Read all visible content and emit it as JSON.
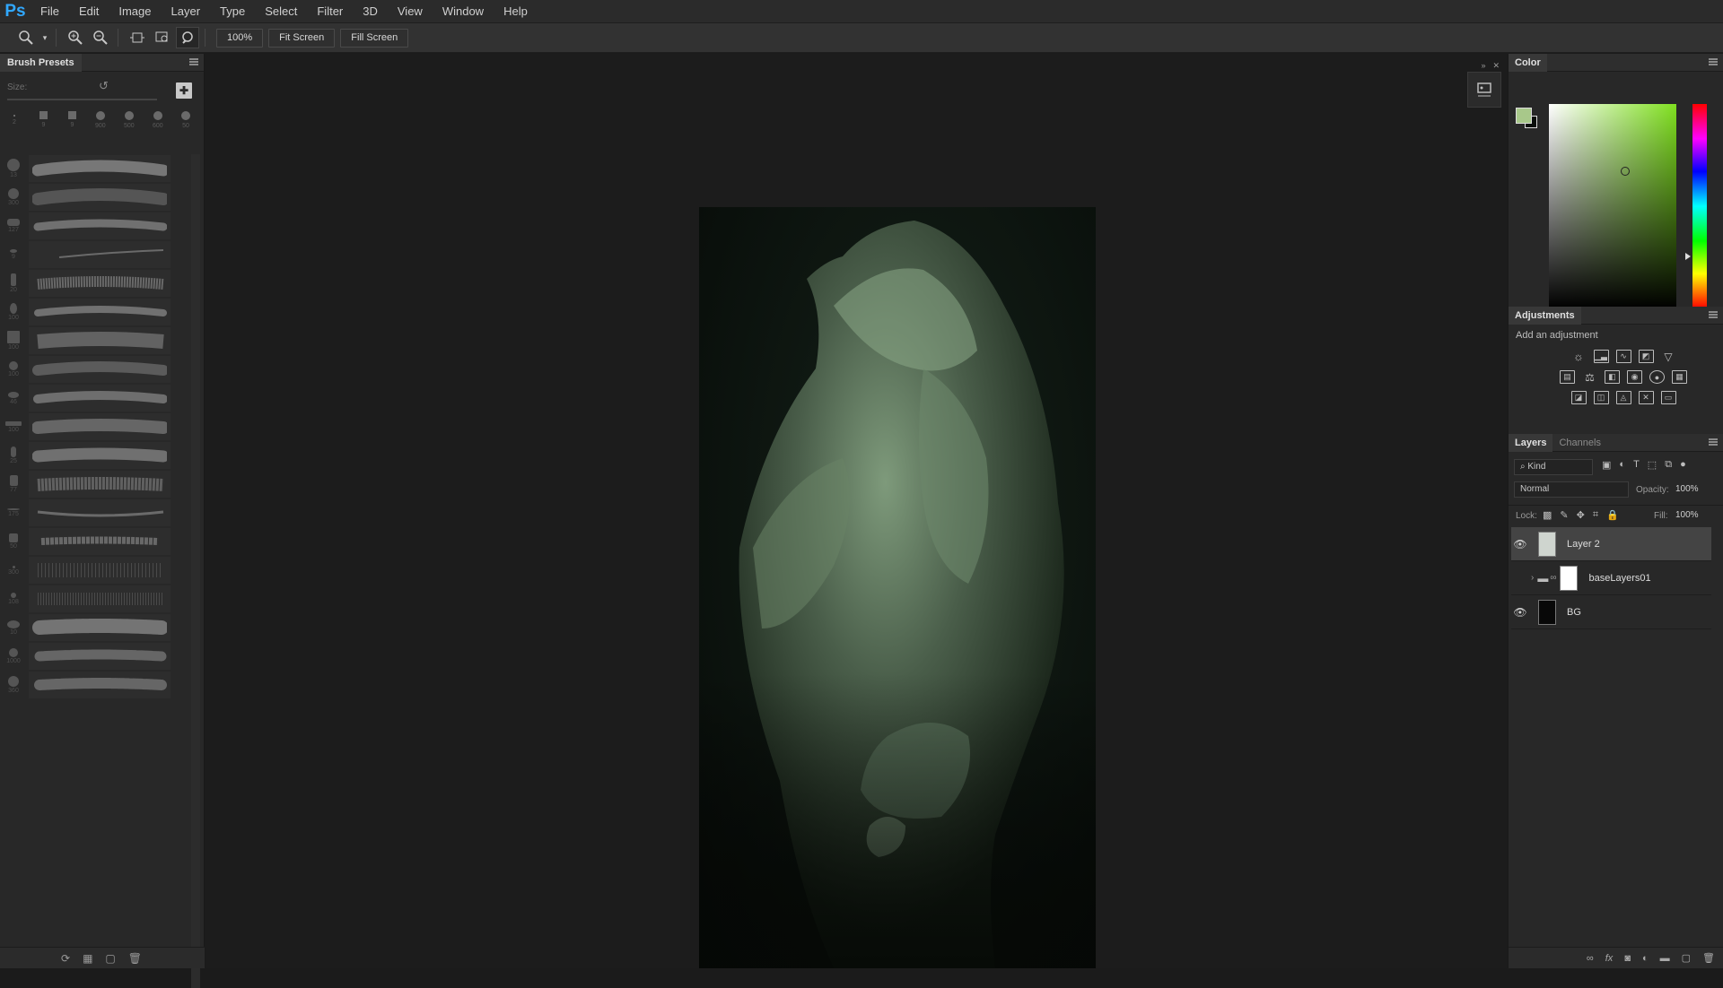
{
  "app": {
    "logo": "Ps"
  },
  "menu": [
    "File",
    "Edit",
    "Image",
    "Layer",
    "Type",
    "Select",
    "Filter",
    "3D",
    "View",
    "Window",
    "Help"
  ],
  "options": {
    "zoom_value": "100%",
    "fit_screen": "Fit Screen",
    "fill_screen": "Fill Screen"
  },
  "brush_presets": {
    "title": "Brush Presets",
    "size_label": "Size:",
    "tip_sizes": [
      "2",
      "9",
      "9",
      "900",
      "500",
      "600",
      "50"
    ],
    "stroke_sizes": [
      "13",
      "300",
      "127",
      "9",
      "20",
      "100",
      "100",
      "100",
      "46",
      "100",
      "25",
      "77",
      "175",
      "50",
      "300",
      "108",
      "10",
      "1000",
      "360",
      "414"
    ]
  },
  "color_panel": {
    "title": "Color",
    "foreground": "#a8c88a",
    "background": "#0b0f0c"
  },
  "adjustments": {
    "title": "Adjustments",
    "subtitle": "Add an adjustment"
  },
  "layers_panel": {
    "tabs": [
      "Layers",
      "Channels"
    ],
    "kind": "Kind",
    "blend_mode": "Normal",
    "opacity_label": "Opacity:",
    "opacity": "100%",
    "lock_label": "Lock:",
    "fill_label": "Fill:",
    "fill": "100%",
    "layers": [
      {
        "name": "Layer 2",
        "visible": true,
        "selected": true
      },
      {
        "name": "baseLayers01",
        "visible": false,
        "selected": false,
        "group": true
      },
      {
        "name": "BG",
        "visible": true,
        "selected": false
      }
    ]
  }
}
